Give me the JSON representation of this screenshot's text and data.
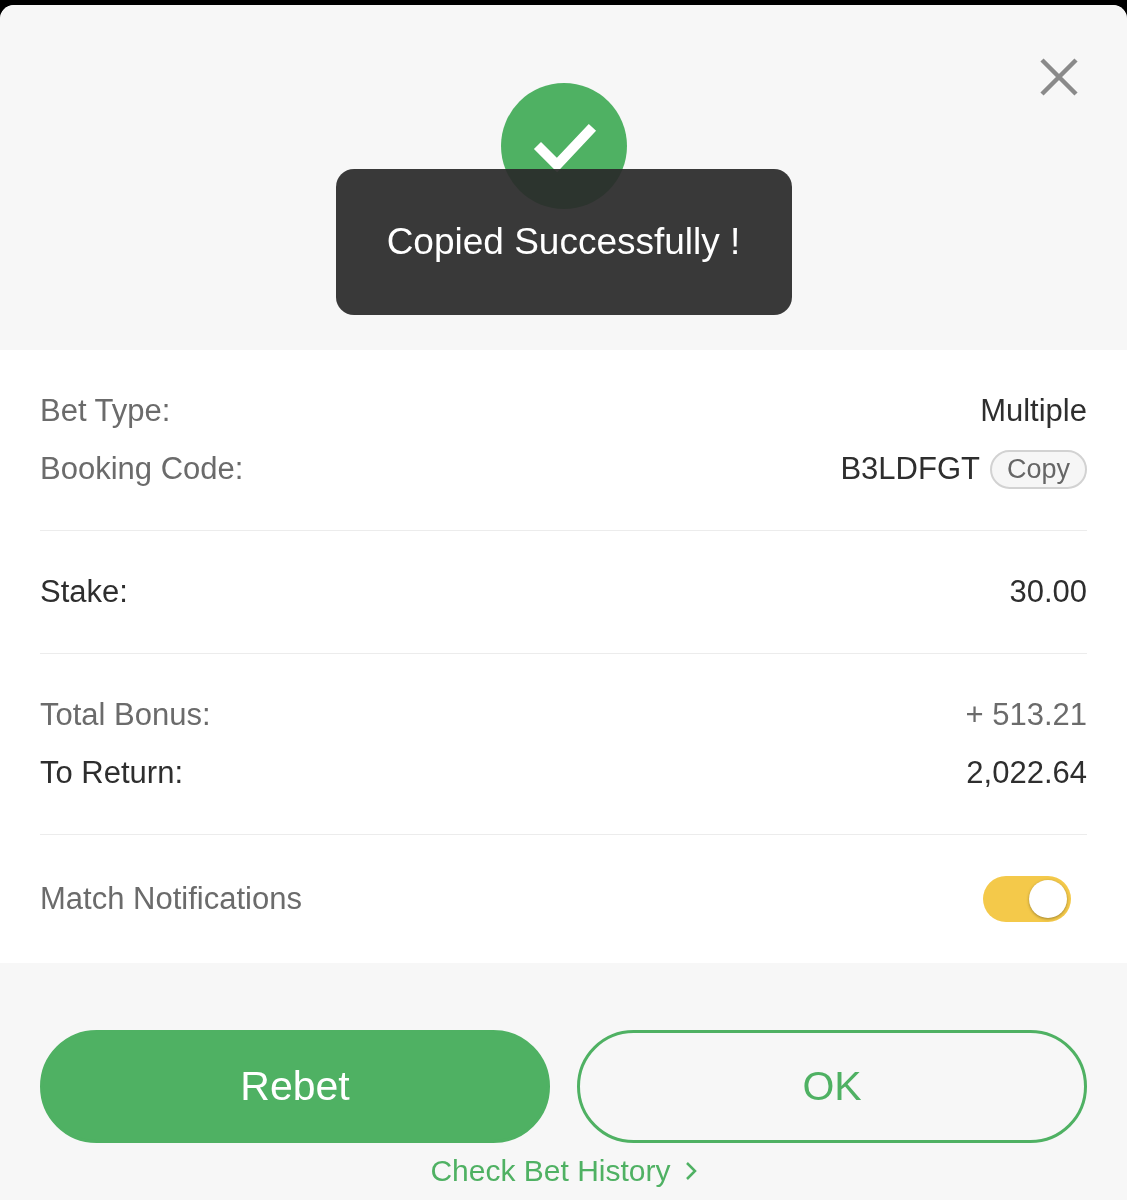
{
  "toast": {
    "message": "Copied Successfully !"
  },
  "details": [
    {
      "rows": [
        {
          "kind": "info",
          "label": "Bet Type:",
          "value": "Multiple"
        },
        {
          "kind": "info",
          "label": "Booking Code:",
          "value": "B3LDFGT",
          "action": "Copy"
        }
      ]
    },
    {
      "rows": [
        {
          "kind": "strong",
          "label": "Stake:",
          "value": "30.00"
        }
      ]
    },
    {
      "rows": [
        {
          "kind": "muted",
          "label": "Total Bonus:",
          "value": "+ 513.21"
        },
        {
          "kind": "strong",
          "label": "To Return:",
          "value": "2,022.64"
        }
      ]
    }
  ],
  "notifications": {
    "label": "Match Notifications",
    "on": true
  },
  "buttons": [
    {
      "kind": "filled",
      "label": "Rebet"
    },
    {
      "kind": "outline",
      "label": "OK"
    }
  ],
  "history_link": {
    "label": "Check Bet History"
  }
}
